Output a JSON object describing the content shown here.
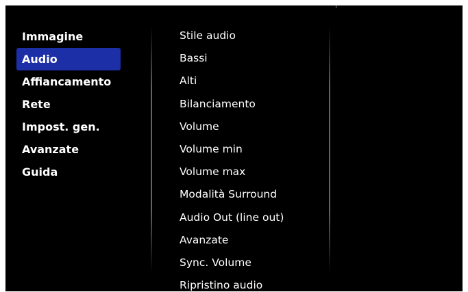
{
  "main_menu": {
    "items": [
      {
        "label": "Immagine",
        "selected": false
      },
      {
        "label": "Audio",
        "selected": true
      },
      {
        "label": "Affiancamento",
        "selected": false
      },
      {
        "label": "Rete",
        "selected": false
      },
      {
        "label": "Impost. gen.",
        "selected": false
      },
      {
        "label": "Avanzate",
        "selected": false
      },
      {
        "label": "Guida",
        "selected": false
      }
    ]
  },
  "audio_menu": {
    "items": [
      {
        "label": "Stile audio"
      },
      {
        "label": "Bassi"
      },
      {
        "label": "Alti"
      },
      {
        "label": "Bilanciamento"
      },
      {
        "label": "Volume"
      },
      {
        "label": "Volume min"
      },
      {
        "label": "Volume max"
      },
      {
        "label": "Modalità Surround"
      },
      {
        "label": "Audio Out (line out)"
      },
      {
        "label": "Avanzate"
      },
      {
        "label": "Sync. Volume"
      },
      {
        "label": "Ripristino audio"
      }
    ]
  },
  "colors": {
    "background": "#000000",
    "selection": "#1d2fa6",
    "text": "#ffffff",
    "divider": "#6e6e6e"
  }
}
